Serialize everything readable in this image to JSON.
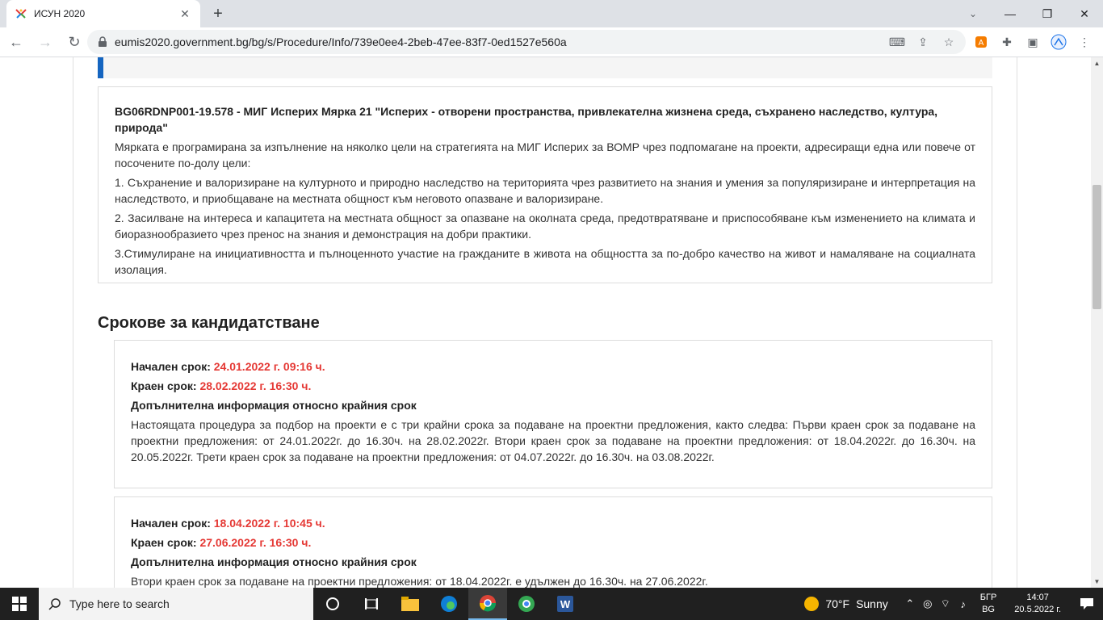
{
  "browser": {
    "tab_title": "ИСУН 2020",
    "tab_close": "✕",
    "new_tab": "+",
    "url": "eumis2020.government.bg/bg/s/Procedure/Info/739e0ee4-2beb-47ee-83f7-0ed1527e560a",
    "controls": {
      "minimize": "—",
      "restore": "❐",
      "close": "✕",
      "tab_search": "⌄"
    },
    "nav": {
      "back": "←",
      "forward": "→",
      "reload": "↻"
    },
    "omni_icons": {
      "translate": "⌨",
      "share": "⇪",
      "bookmark": "☆"
    },
    "ext_icons": {
      "extensions": "✚",
      "sidepanel": "▣",
      "menu": "⋮"
    }
  },
  "measure": {
    "title": "BG06RDNP001-19.578 - МИГ Исперих Мярка 21 \"Исперих - отворени пространства, привлекателна жизнена среда, съхранено наследство, култура, природа\"",
    "paragraphs": [
      "Мярката е програмирана за изпълнение на няколко цели на стратегията на МИГ Исперих за ВОМР чрез подпомагане на проекти, адресиращи една или повече от посочените по-долу цели:",
      "1. Съхранение и валоризиране на културното и природно наследство на територията чрез развитието на знания и умения за популяризиране и интерпретация на наследството, и приобщаване на местната общност към неговото опазване и валоризиране.",
      "2. Засилване на интереса и капацитета на местната общност за опазване на околната среда, предотвратяване и приспособяване към изменението на климата и биоразнообразието чрез пренос на знания и демонстрация на добри практики.",
      "3.Стимулиране на инициативността и пълноценното участие на гражданите в живота на общността за по-добро качество на живот и намаляване на социалната изолация."
    ]
  },
  "deadlines": {
    "heading": "Срокове за кандидатстване",
    "start_label": "Начален срок:",
    "end_label": "Краен срок:",
    "info_heading": "Допълнителна информация относно крайния срок",
    "items": [
      {
        "start": "24.01.2022 г. 09:16 ч.",
        "end": "28.02.2022 г. 16:30 ч.",
        "info": "Настоящата процедура за подбор на проекти е с три крайни срока за подаване на проектни предложения, както следва: Първи краен срок за подаване на проектни предложения: от 24.01.2022г. до 16.30ч. на 28.02.2022г. Втори краен срок за подаване на проектни предложения: от 18.04.2022г. до 16.30ч. на 20.05.2022г. Трети краен срок за подаване на проектни предложения: от 04.07.2022г. до 16.30ч. на 03.08.2022г."
      },
      {
        "start": "18.04.2022 г. 10:45 ч.",
        "end": "27.06.2022 г. 16:30 ч.",
        "info": "Втори краен срок за подаване на проектни предложения: от 18.04.2022г. е удължен до 16.30ч. на 27.06.2022г."
      }
    ]
  },
  "taskbar": {
    "search_placeholder": "Type here to search",
    "weather_temp": "70°F",
    "weather_desc": "Sunny",
    "lang_top": "БГР",
    "lang_bottom": "BG",
    "time": "14:07",
    "date": "20.5.2022 г."
  },
  "colors": {
    "accent_bar": "#1565c0",
    "deadline_value": "#e53935"
  }
}
